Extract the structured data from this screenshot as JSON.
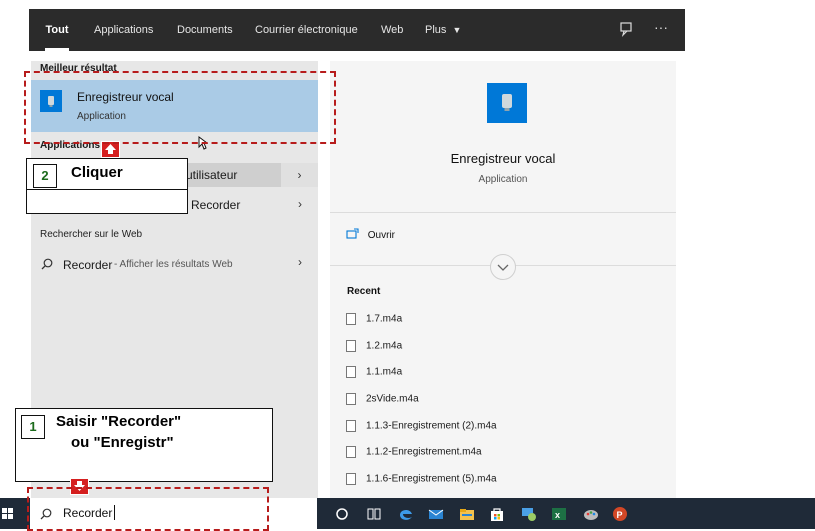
{
  "tabs": [
    {
      "label": "Tout",
      "active": true
    },
    {
      "label": "Applications",
      "active": false
    },
    {
      "label": "Documents",
      "active": false
    },
    {
      "label": "Courrier électronique",
      "active": false
    },
    {
      "label": "Web",
      "active": false
    },
    {
      "label": "Plus",
      "active": false
    }
  ],
  "left": {
    "best_header": "Meilleur résultat",
    "best": {
      "title": "Enregistreur vocal",
      "subtitle": "Application"
    },
    "apps_header": "Applications",
    "apps": [
      {
        "label": "utilisateur"
      },
      {
        "label": "Recorder"
      }
    ],
    "web_header": "Rechercher sur le Web",
    "web_result": {
      "query": "Recorder",
      "suffix": " - Afficher les résultats Web"
    }
  },
  "right": {
    "title": "Enregistreur vocal",
    "subtitle": "Application",
    "open_label": "Ouvrir",
    "recent_header": "Recent",
    "files": [
      "1.7.m4a",
      "1.2.m4a",
      "1.1.m4a",
      "2sVide.m4a",
      "1.1.3-Enregistrement (2).m4a",
      "1.1.2-Enregistrement.m4a",
      "1.1.6-Enregistrement (5).m4a"
    ]
  },
  "callouts": {
    "step1_num": "1",
    "step1_line1": "Saisir \"Recorder\"",
    "step1_line2": "ou \"Enregistr\"",
    "step2_num": "2",
    "step2_text": "Cliquer"
  },
  "search": {
    "value": "Recorder"
  },
  "colors": {
    "accent": "#0078d7",
    "highlight": "#aacbe6",
    "callout_border": "#b71c1c"
  }
}
